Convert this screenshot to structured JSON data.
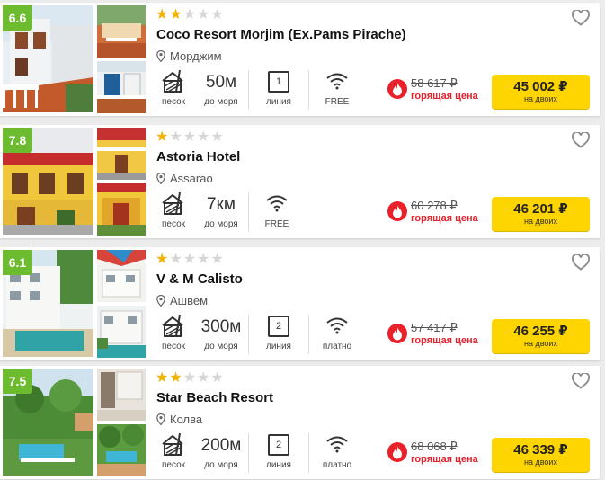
{
  "hotels": [
    {
      "rating": "6.6",
      "stars": 2,
      "name": "Coco Resort Morjim (Ex.Pams Pirache)",
      "location": "Морджим",
      "beach_label": "песок",
      "distance_value": "50м",
      "distance_label": "до моря",
      "line_value": "1",
      "line_label": "линия",
      "wifi_label": "FREE",
      "old_price": "58 617 ₽",
      "hot_label": "горящая цена",
      "price": "45 002 ₽",
      "price_sub": "на двоих"
    },
    {
      "rating": "7.8",
      "stars": 1,
      "name": "Astoria Hotel",
      "location": "Assarao",
      "beach_label": "песок",
      "distance_value": "7км",
      "distance_label": "до моря",
      "wifi_label": "FREE",
      "old_price": "60 278 ₽",
      "hot_label": "горящая цена",
      "price": "46 201 ₽",
      "price_sub": "на двоих"
    },
    {
      "rating": "6.1",
      "stars": 1,
      "name": "V & M Calisto",
      "location": "Ашвем",
      "beach_label": "песок",
      "distance_value": "300м",
      "distance_label": "до моря",
      "line_value": "2",
      "line_label": "линия",
      "wifi_label": "платно",
      "old_price": "57 417 ₽",
      "hot_label": "горящая цена",
      "price": "46 255 ₽",
      "price_sub": "на двоих"
    },
    {
      "rating": "7.5",
      "stars": 2,
      "name": "Star Beach Resort",
      "location": "Колва",
      "beach_label": "песок",
      "distance_value": "200м",
      "distance_label": "до моря",
      "line_value": "2",
      "line_label": "линия",
      "wifi_label": "платно",
      "old_price": "68 068 ₽",
      "hot_label": "горящая цена",
      "price": "46 339 ₽",
      "price_sub": "на двоих"
    }
  ],
  "colors": {
    "rating_badge": "#6dbb2f",
    "star_on": "#f3b300",
    "star_off": "#d6d6d6",
    "hot_red": "#e8212a",
    "price_button": "#ffd500"
  },
  "icons": [
    "heart-icon",
    "pin-icon",
    "sand-beach-icon",
    "wifi-icon",
    "fire-icon"
  ]
}
